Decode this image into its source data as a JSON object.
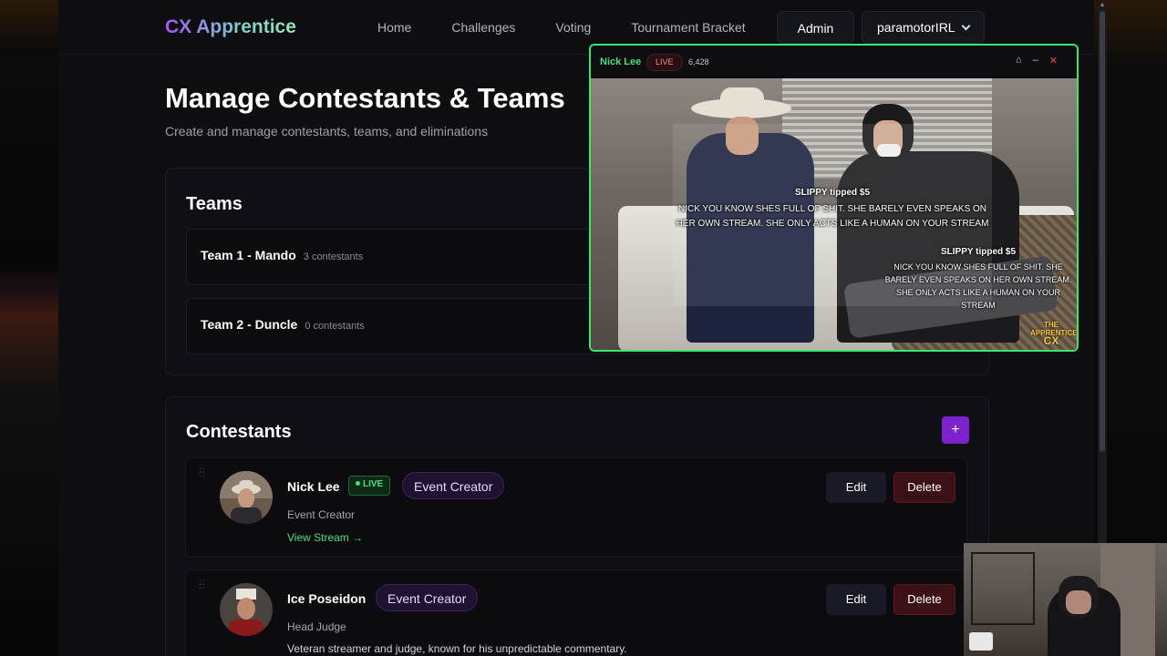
{
  "nav": {
    "brand": "CX Apprentice",
    "links": [
      "Home",
      "Challenges",
      "Voting",
      "Tournament Bracket"
    ],
    "admin": "Admin",
    "user": "paramotorIRL"
  },
  "header": {
    "title": "Manage Contestants & Teams",
    "subtitle": "Create and manage contestants, teams, and eliminations"
  },
  "teams": {
    "title": "Teams",
    "items": [
      {
        "name": "Team 1 - Mando",
        "count": "3 contestants"
      },
      {
        "name": "Team 2 - Duncle",
        "count": "0 contestants"
      }
    ]
  },
  "contestants": {
    "title": "Contestants",
    "add_label": "+",
    "items": [
      {
        "name": "Nick Lee",
        "live": "LIVE",
        "badge": "Event Creator",
        "role": "Event Creator",
        "link": "View Stream →",
        "edit": "Edit",
        "delete": "Delete"
      },
      {
        "name": "Ice Poseidon",
        "badge": "Event Creator",
        "role": "Head Judge",
        "desc": "Veteran streamer and judge, known for his unpredictable commentary.",
        "edit": "Edit",
        "delete": "Delete"
      }
    ]
  },
  "stream": {
    "name": "Nick Lee",
    "live": "LIVE",
    "viewers": "6,428",
    "tip1_header": "SLIPPY tipped $5",
    "tip1_text": "NICK YOU KNOW SHES FULL OF SHIT. SHE BARELY EVEN SPEAKS ON HER OWN STREAM. SHE ONLY ACTS LIKE A HUMAN ON YOUR STREAM",
    "tip2_header": "SLIPPY tipped $5",
    "tip2_text": "NICK YOU KNOW SHES FULL OF SHIT. SHE BARELY EVEN SPEAKS ON HER OWN STREAM. SHE ONLY ACTS LIKE A HUMAN ON YOUR STREAM",
    "logo_top": "THE APPRENTICE",
    "logo_bottom": "CX"
  },
  "colors": {
    "accent": "#7e22ce",
    "live_green": "#4ade80",
    "delete_red": "#3b1116"
  }
}
